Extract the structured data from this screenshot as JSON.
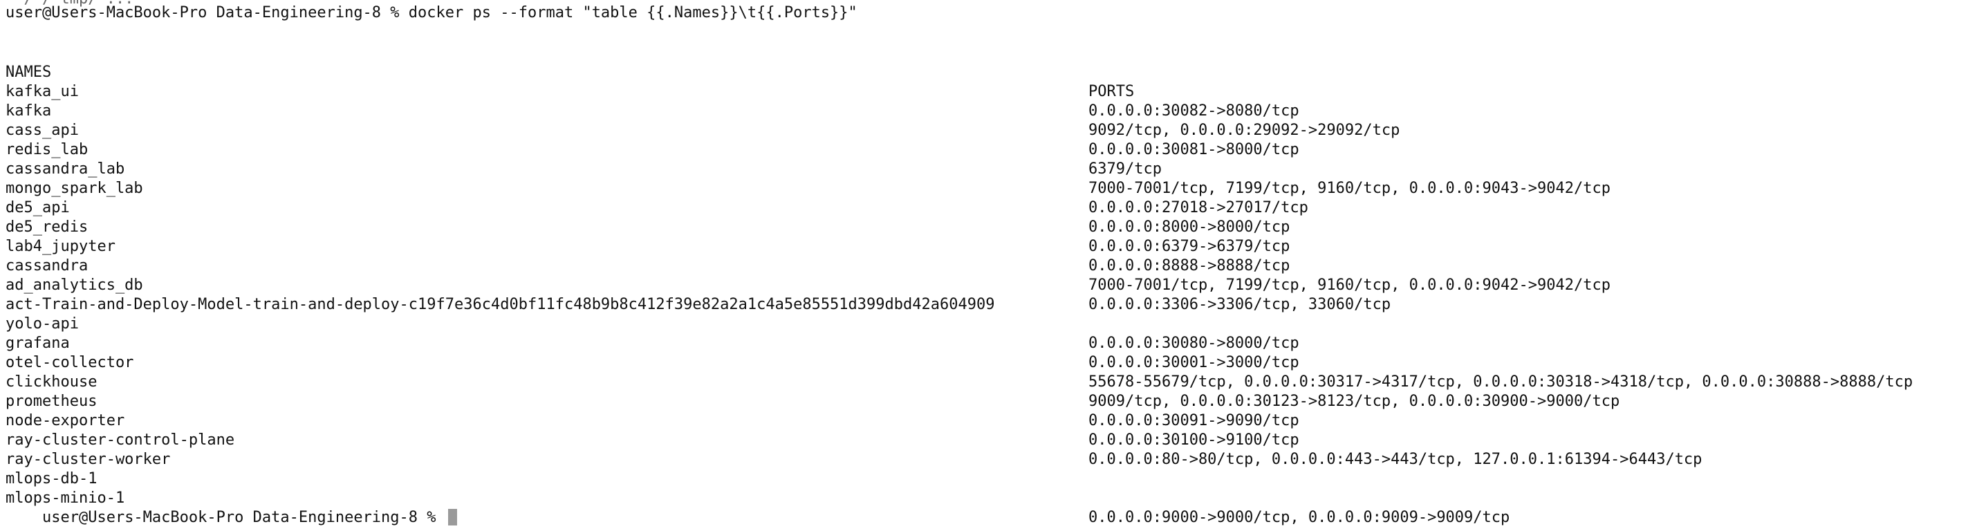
{
  "terminal": {
    "clipped_previous_line": "~ / / tmp/ ...",
    "command_prompt": "user@Users-MacBook-Pro Data-Engineering-8 % docker ps --format \"table {{.Names}}\\t{{.Ports}}\"",
    "headers": {
      "names": "NAMES",
      "ports": "PORTS"
    },
    "rows": [
      {
        "name": "kafka_ui",
        "ports": "0.0.0.0:30082->8080/tcp"
      },
      {
        "name": "kafka",
        "ports": "9092/tcp, 0.0.0.0:29092->29092/tcp"
      },
      {
        "name": "cass_api",
        "ports": "0.0.0.0:30081->8000/tcp"
      },
      {
        "name": "redis_lab",
        "ports": "6379/tcp"
      },
      {
        "name": "cassandra_lab",
        "ports": "7000-7001/tcp, 7199/tcp, 9160/tcp, 0.0.0.0:9043->9042/tcp"
      },
      {
        "name": "mongo_spark_lab",
        "ports": "0.0.0.0:27018->27017/tcp"
      },
      {
        "name": "de5_api",
        "ports": "0.0.0.0:8000->8000/tcp"
      },
      {
        "name": "de5_redis",
        "ports": "0.0.0.0:6379->6379/tcp"
      },
      {
        "name": "lab4_jupyter",
        "ports": "0.0.0.0:8888->8888/tcp"
      },
      {
        "name": "cassandra",
        "ports": "7000-7001/tcp, 7199/tcp, 9160/tcp, 0.0.0.0:9042->9042/tcp"
      },
      {
        "name": "ad_analytics_db",
        "ports": "0.0.0.0:3306->3306/tcp, 33060/tcp"
      },
      {
        "name": "act-Train-and-Deploy-Model-train-and-deploy-c19f7e36c4d0bf11fc48b9b8c412f39e82a2a1c4a5e85551d399dbd42a604909",
        "ports": ""
      },
      {
        "name": "yolo-api",
        "ports": "0.0.0.0:30080->8000/tcp"
      },
      {
        "name": "grafana",
        "ports": "0.0.0.0:30001->3000/tcp"
      },
      {
        "name": "otel-collector",
        "ports": "55678-55679/tcp, 0.0.0.0:30317->4317/tcp, 0.0.0.0:30318->4318/tcp, 0.0.0.0:30888->8888/tcp"
      },
      {
        "name": "clickhouse",
        "ports": "9009/tcp, 0.0.0.0:30123->8123/tcp, 0.0.0.0:30900->9000/tcp"
      },
      {
        "name": "prometheus",
        "ports": "0.0.0.0:30091->9090/tcp"
      },
      {
        "name": "node-exporter",
        "ports": "0.0.0.0:30100->9100/tcp"
      },
      {
        "name": "ray-cluster-control-plane",
        "ports": "0.0.0.0:80->80/tcp, 0.0.0.0:443->443/tcp, 127.0.0.1:61394->6443/tcp"
      },
      {
        "name": "ray-cluster-worker",
        "ports": ""
      },
      {
        "name": "mlops-db-1",
        "ports": ""
      },
      {
        "name": "mlops-minio-1",
        "ports": "0.0.0.0:9000->9000/tcp, 0.0.0.0:9009->9009/tcp"
      }
    ],
    "final_prompt": "user@Users-MacBook-Pro Data-Engineering-8 % "
  }
}
